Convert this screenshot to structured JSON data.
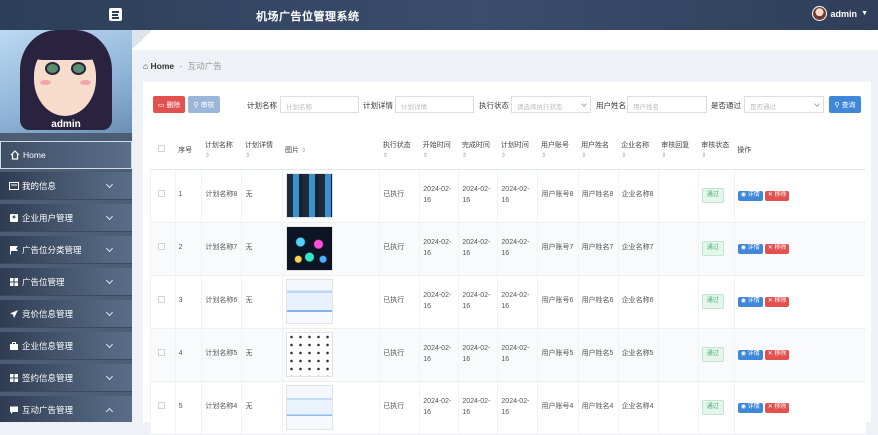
{
  "header": {
    "title": "机场广告位管理系统",
    "user": "admin"
  },
  "sidebar": {
    "profile_name": "admin",
    "items": [
      {
        "label": "Home",
        "icon": "home-icon"
      },
      {
        "label": "我的信息",
        "icon": "id-card-icon"
      },
      {
        "label": "企业用户管理",
        "icon": "user-badge-icon"
      },
      {
        "label": "广告位分类管理",
        "icon": "flag-icon"
      },
      {
        "label": "广告位管理",
        "icon": "grid-icon"
      },
      {
        "label": "竞价信息管理",
        "icon": "send-icon"
      },
      {
        "label": "企业信息管理",
        "icon": "briefcase-icon"
      },
      {
        "label": "签约信息管理",
        "icon": "grid-icon"
      },
      {
        "label": "互动广告管理",
        "icon": "chat-icon"
      }
    ]
  },
  "breadcrumb": {
    "home": "Home",
    "sep": "-",
    "current": "互动广告"
  },
  "toolbar": {
    "delete": "删除",
    "review": "审核",
    "plan_name_label": "计划名称",
    "plan_name_ph": "计划名称",
    "plan_detail_label": "计划详情",
    "plan_detail_ph": "计划详情",
    "exec_status_label": "执行状态",
    "exec_status_ph": "请选择执行状态",
    "user_name_label": "用户姓名",
    "user_name_ph": "用户姓名",
    "pass_label": "是否通过",
    "pass_ph": "是否通过",
    "search": "查询"
  },
  "table": {
    "headers": [
      "序号",
      "计划名称",
      "计划详情",
      "图片",
      "执行状态",
      "开始时间",
      "完成时间",
      "计划时间",
      "用户账号",
      "用户姓名",
      "企业名称",
      "审核回复",
      "审核状态",
      "操作"
    ],
    "rows": [
      {
        "no": "1",
        "plan_name": "计划名称8",
        "detail": "无",
        "status": "已执行",
        "start": "2024-02-16",
        "finish": "2024-02-16",
        "plan_time": "2024-02-16",
        "account": "用户账号8",
        "user_name": "用户姓名8",
        "company": "企业名称8",
        "reply": "",
        "review": "通过"
      },
      {
        "no": "2",
        "plan_name": "计划名称7",
        "detail": "无",
        "status": "已执行",
        "start": "2024-02-16",
        "finish": "2024-02-16",
        "plan_time": "2024-02-16",
        "account": "用户账号7",
        "user_name": "用户姓名7",
        "company": "企业名称7",
        "reply": "",
        "review": "通过"
      },
      {
        "no": "3",
        "plan_name": "计划名称6",
        "detail": "无",
        "status": "已执行",
        "start": "2024-02-16",
        "finish": "2024-02-16",
        "plan_time": "2024-02-16",
        "account": "用户账号6",
        "user_name": "用户姓名6",
        "company": "企业名称6",
        "reply": "",
        "review": "通过"
      },
      {
        "no": "4",
        "plan_name": "计划名称5",
        "detail": "无",
        "status": "已执行",
        "start": "2024-02-16",
        "finish": "2024-02-16",
        "plan_time": "2024-02-16",
        "account": "用户账号5",
        "user_name": "用户姓名5",
        "company": "企业名称5",
        "reply": "",
        "review": "通过"
      },
      {
        "no": "5",
        "plan_name": "计划名称4",
        "detail": "无",
        "status": "已执行",
        "start": "2024-02-16",
        "finish": "2024-02-16",
        "plan_time": "2024-02-16",
        "account": "用户账号4",
        "user_name": "用户姓名4",
        "company": "企业名称4",
        "reply": "",
        "review": "通过"
      }
    ],
    "detail_btn": "详情",
    "remove_btn": "移除"
  }
}
